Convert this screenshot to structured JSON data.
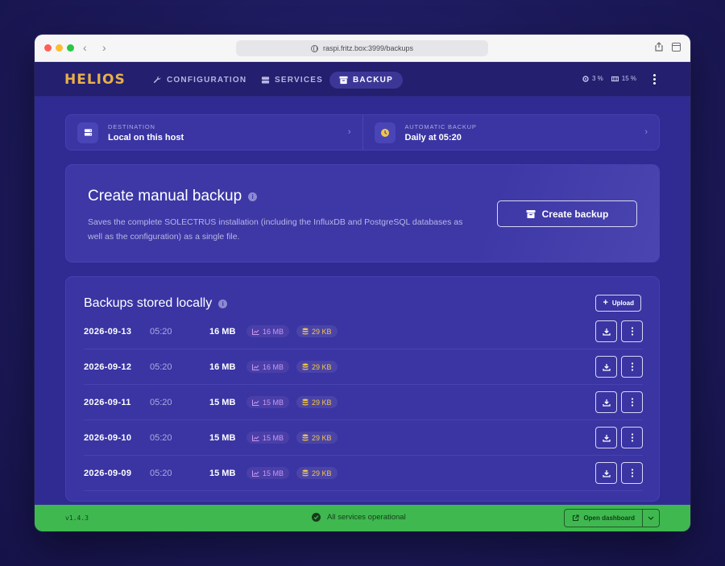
{
  "browser": {
    "url": "raspi.fritz.box:3999/backups"
  },
  "app": {
    "logo": "HELIOS",
    "nav": [
      {
        "label": "CONFIGURATION",
        "icon": "wrench-icon",
        "active": false
      },
      {
        "label": "SERVICES",
        "icon": "database-icon",
        "active": false
      },
      {
        "label": "BACKUP",
        "icon": "archive-icon",
        "active": true
      }
    ],
    "stats": {
      "cpu": "3 %",
      "memory": "15 %"
    }
  },
  "summary": {
    "destination": {
      "label": "DESTINATION",
      "value": "Local on this host"
    },
    "automatic": {
      "label": "AUTOMATIC BACKUP",
      "value": "Daily at 05:20"
    }
  },
  "manual": {
    "title": "Create manual backup",
    "description": "Saves the complete SOLECTRUS installation (including the InfluxDB and PostgreSQL databases as well as the configuration) as a single file.",
    "button_label": "Create backup"
  },
  "stored": {
    "title": "Backups stored locally",
    "upload_label": "Upload",
    "rows": [
      {
        "date": "2026-09-13",
        "time": "05:20",
        "size": "16 MB",
        "influx": "16 MB",
        "postgres": "29 KB"
      },
      {
        "date": "2026-09-12",
        "time": "05:20",
        "size": "16 MB",
        "influx": "16 MB",
        "postgres": "29 KB"
      },
      {
        "date": "2026-09-11",
        "time": "05:20",
        "size": "15 MB",
        "influx": "15 MB",
        "postgres": "29 KB"
      },
      {
        "date": "2026-09-10",
        "time": "05:20",
        "size": "15 MB",
        "influx": "15 MB",
        "postgres": "29 KB"
      },
      {
        "date": "2026-09-09",
        "time": "05:20",
        "size": "15 MB",
        "influx": "15 MB",
        "postgres": "29 KB"
      }
    ]
  },
  "footer": {
    "version": "v1.4.3",
    "status": "All services operational",
    "dashboard_label": "Open dashboard"
  },
  "colors": {
    "accent_logo": "#e8b04a",
    "background": "#302b93",
    "footer": "#3fb84f",
    "influx_pill": "#c79af0",
    "postgres_pill": "#f0c64a"
  }
}
